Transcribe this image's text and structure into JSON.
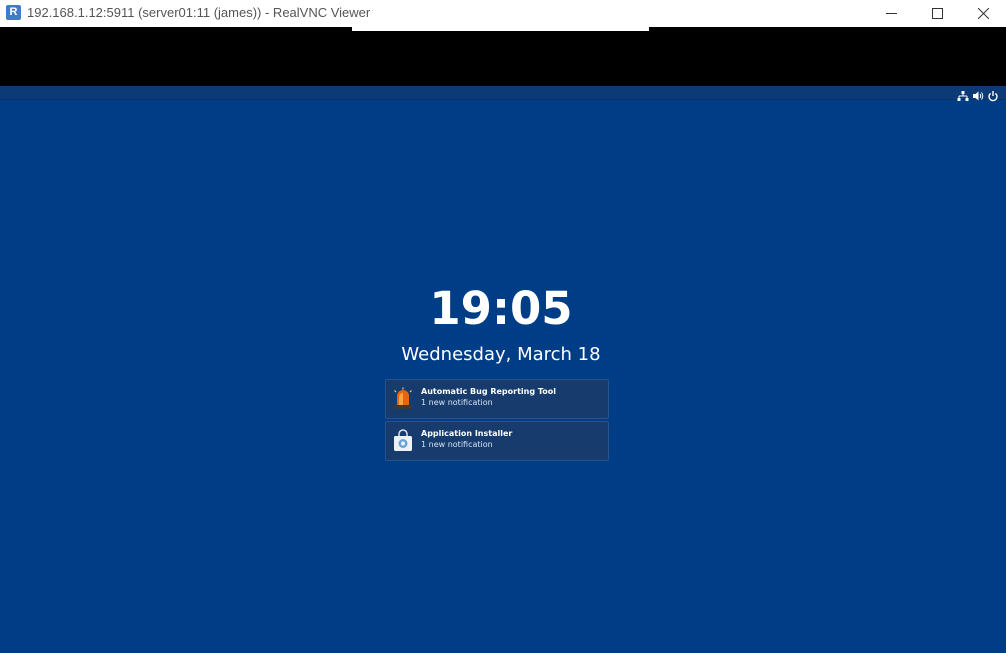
{
  "window": {
    "title": "192.168.1.12:5911 (server01:11 (james)) - RealVNC Viewer",
    "app_icon_letter": "R",
    "controls": [
      "minimize",
      "maximize",
      "close"
    ]
  },
  "top_panel": {
    "icons": [
      "network-icon",
      "volume-icon",
      "power-icon"
    ]
  },
  "lock_screen": {
    "time": "19:05",
    "date": "Wednesday, March 18",
    "notifications": [
      {
        "icon": "alarm-light-icon",
        "title": "Automatic Bug Reporting Tool",
        "subtitle": "1 new notification"
      },
      {
        "icon": "software-bag-icon",
        "title": "Application Installer",
        "subtitle": "1 new notification"
      }
    ]
  },
  "colors": {
    "desktop_background": "#003d87",
    "notification_background": "#163b6c",
    "title_bar": "#ffffff"
  }
}
